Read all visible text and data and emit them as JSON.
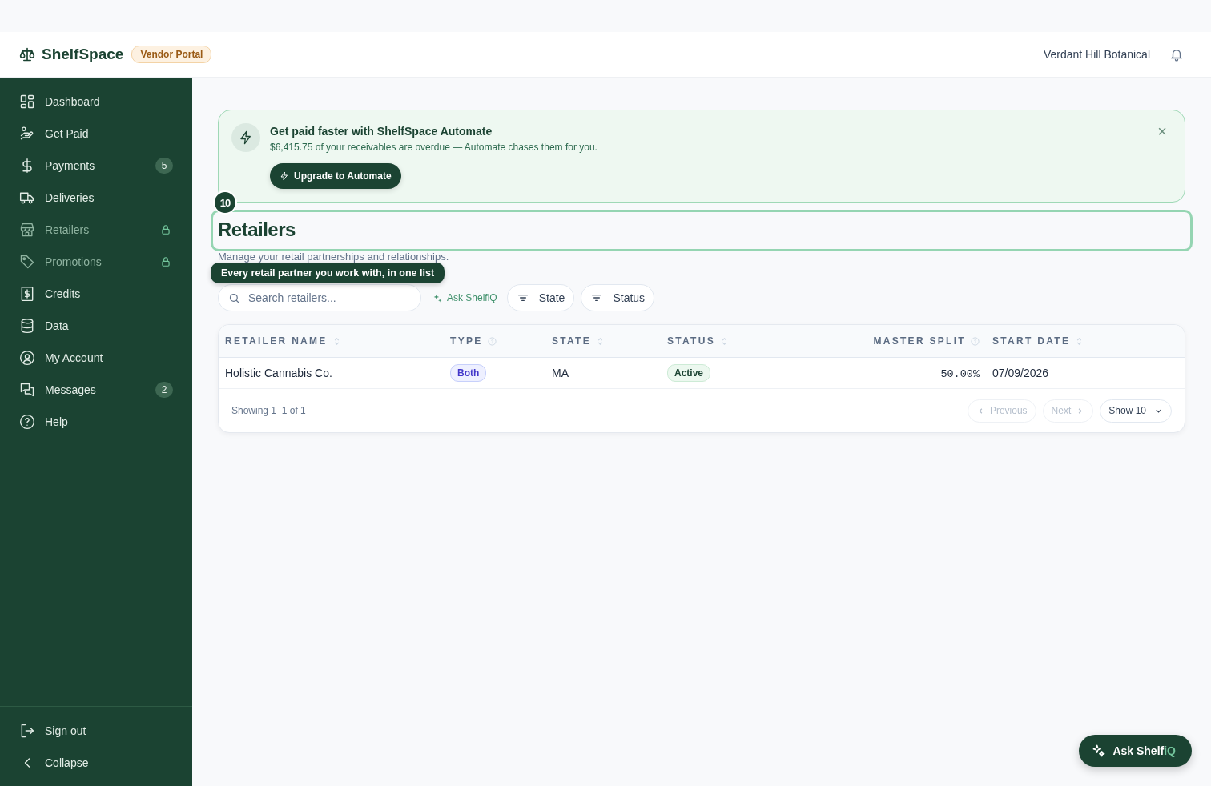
{
  "header": {
    "brand": "ShelfSpace",
    "badge": "Vendor Portal",
    "account": "Verdant Hill Botanical"
  },
  "sidebar": {
    "items": [
      {
        "label": "Dashboard",
        "locked": false
      },
      {
        "label": "Get Paid",
        "locked": false
      },
      {
        "label": "Payments",
        "locked": false,
        "badge": "5"
      },
      {
        "label": "Deliveries",
        "locked": false
      },
      {
        "label": "Retailers",
        "locked": true
      },
      {
        "label": "Promotions",
        "locked": true
      },
      {
        "label": "Credits",
        "locked": false
      },
      {
        "label": "Data",
        "locked": false
      },
      {
        "label": "My Account",
        "locked": false
      },
      {
        "label": "Messages",
        "locked": false,
        "badge": "2"
      },
      {
        "label": "Help",
        "locked": false
      }
    ],
    "footer": [
      "Sign out",
      "Collapse"
    ]
  },
  "banner": {
    "title": "Get paid faster with ShelfSpace Automate",
    "text": "$6,415.75 of your receivables are overdue — Automate chases them for you.",
    "button": "Upgrade to Automate",
    "dismiss": "×"
  },
  "tour": {
    "step": "10",
    "tooltip": "Every retail partner you work with, in one list"
  },
  "page": {
    "title": "Retailers",
    "subtitle": "Manage your retail partnerships and relationships."
  },
  "toolbar": {
    "search_placeholder": "Search retailers...",
    "ask": "Ask ShelfiQ",
    "filters": [
      "State",
      "Status"
    ]
  },
  "table": {
    "columns": [
      {
        "label": "RETAILER NAME",
        "kind": "sortable"
      },
      {
        "label": "TYPE",
        "kind": "help"
      },
      {
        "label": "STATE",
        "kind": "sortable"
      },
      {
        "label": "STATUS",
        "kind": "sortable"
      },
      {
        "label": "MASTER SPLIT",
        "kind": "help"
      },
      {
        "label": "START DATE",
        "kind": "sortable"
      }
    ],
    "rows": [
      {
        "retailer_name": "Holistic Cannabis Co.",
        "type": "Both",
        "state": "MA",
        "status": "Active",
        "master_split": "50.00%",
        "start_date": "07/09/2026"
      }
    ],
    "summary": "Showing 1–1 of 1",
    "pagination": [
      {
        "label": "Previous",
        "kind": "prev",
        "disabled": true
      },
      {
        "label": "Next",
        "kind": "next",
        "disabled": true
      }
    ],
    "page_size": "Show 10"
  },
  "assistant": {
    "label_prefix": "Ask Shelf",
    "label_accent": "iQ"
  }
}
